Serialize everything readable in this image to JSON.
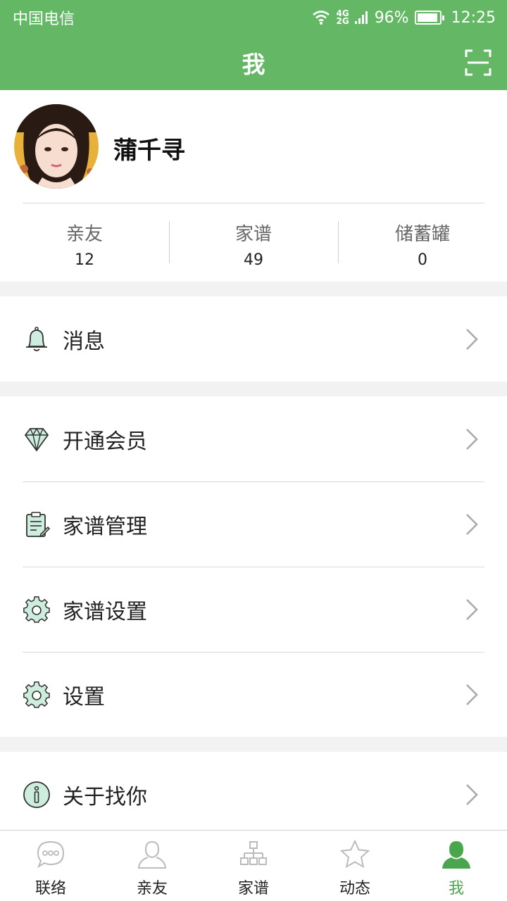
{
  "status_bar": {
    "carrier": "中国电信",
    "network_top": "4G",
    "network_bottom": "2G",
    "battery_percent": "96%",
    "battery_level": 0.96,
    "time": "12:25"
  },
  "header": {
    "title": "我",
    "scan_icon": "scan-icon"
  },
  "profile": {
    "name": "蒲千寻"
  },
  "stats": [
    {
      "label": "亲友",
      "value": "12"
    },
    {
      "label": "家谱",
      "value": "49"
    },
    {
      "label": "储蓄罐",
      "value": "0"
    }
  ],
  "menu": {
    "messages": {
      "label": "消息",
      "icon": "bell-icon"
    },
    "membership": {
      "label": "开通会员",
      "icon": "diamond-icon"
    },
    "genealogy_manage": {
      "label": "家谱管理",
      "icon": "clipboard-icon"
    },
    "genealogy_settings": {
      "label": "家谱设置",
      "icon": "gear-icon"
    },
    "settings": {
      "label": "设置",
      "icon": "gear-icon"
    },
    "about": {
      "label": "关于找你",
      "icon": "info-icon"
    }
  },
  "tabs": [
    {
      "label": "联络",
      "icon": "chat-bubble-icon",
      "active": false
    },
    {
      "label": "亲友",
      "icon": "person-icon",
      "active": false
    },
    {
      "label": "家谱",
      "icon": "tree-chart-icon",
      "active": false
    },
    {
      "label": "动态",
      "icon": "star-icon",
      "active": false
    },
    {
      "label": "我",
      "icon": "person-filled-icon",
      "active": true
    }
  ],
  "colors": {
    "brand_green": "#64b865",
    "active_tab": "#4aa64c",
    "icon_tint": "#cdeedf"
  }
}
